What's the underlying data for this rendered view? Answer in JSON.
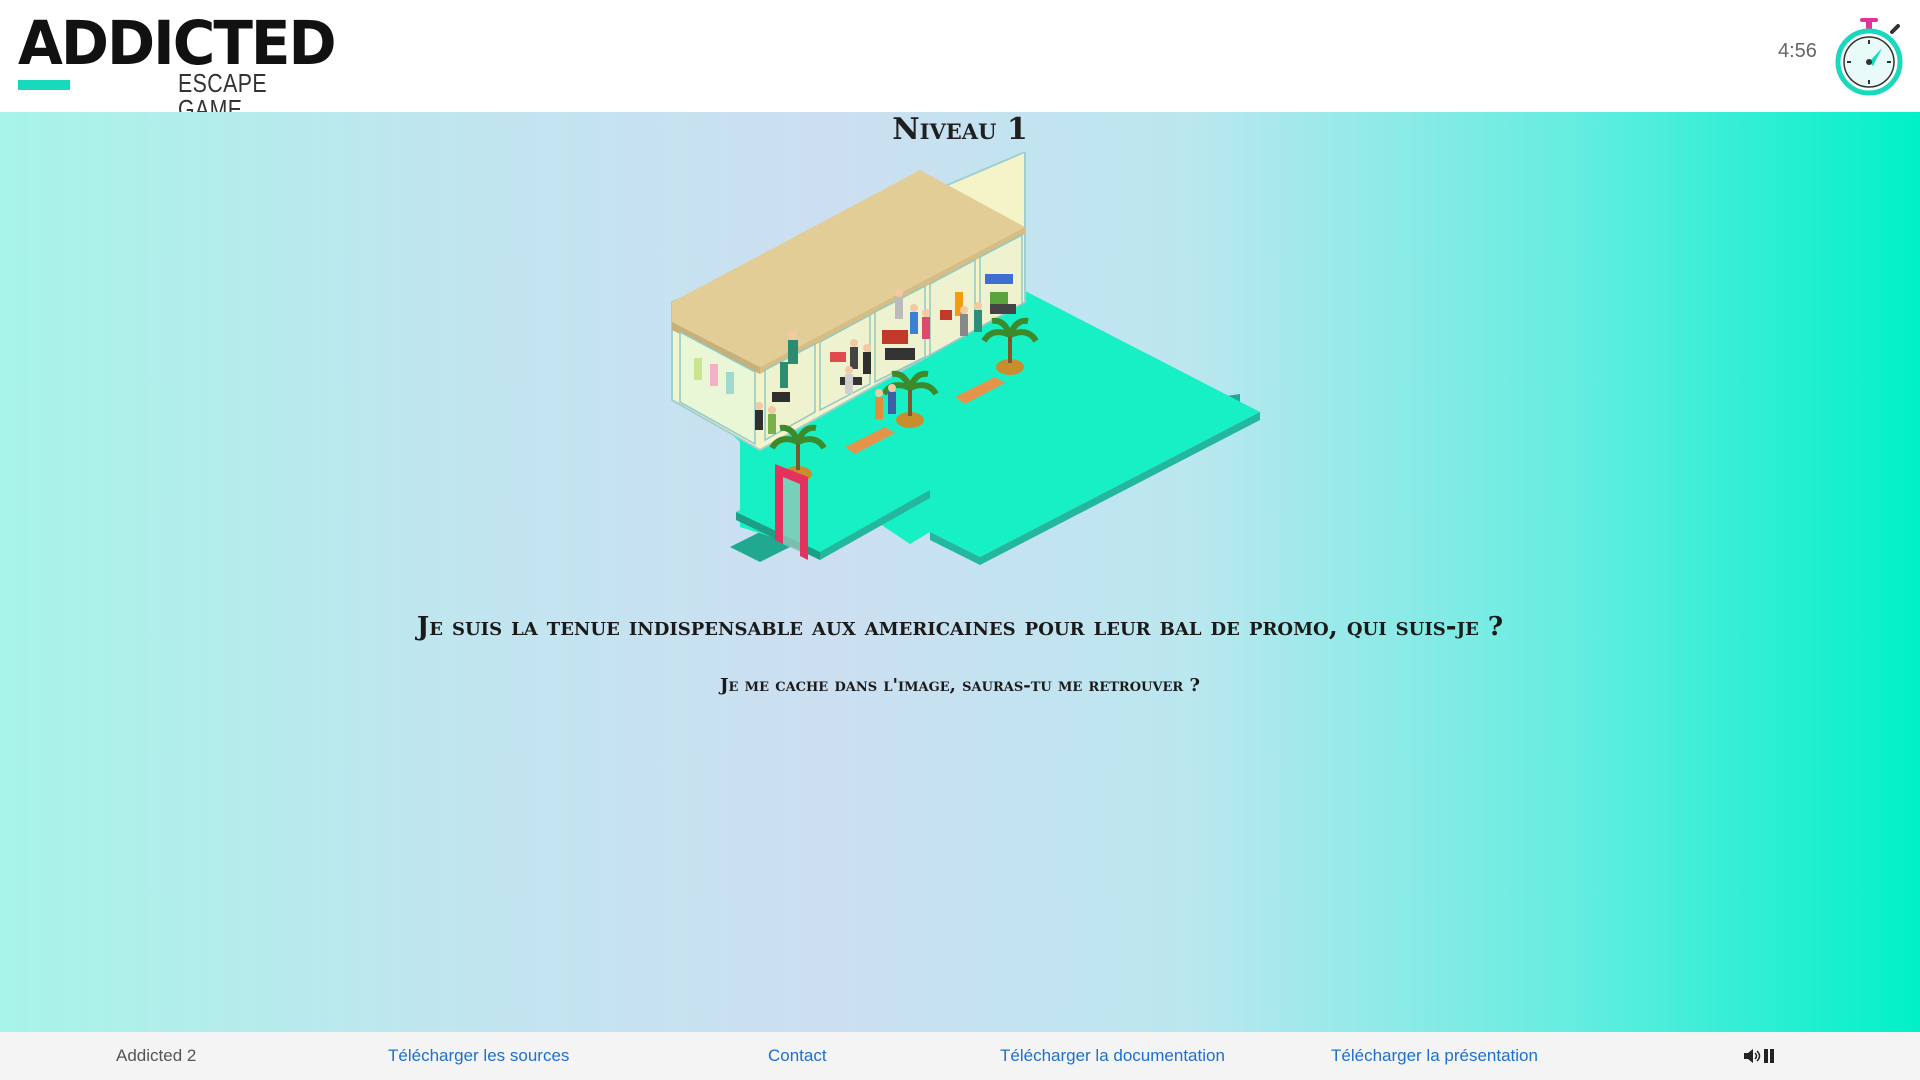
{
  "header": {
    "logo_main": "ADDICTED",
    "logo_sub": "ESCAPE GAME",
    "timer": "4:56",
    "colors": {
      "accent": "#19d9bd",
      "timer_pink": "#e2339a"
    }
  },
  "level": {
    "title": "Niveau 1",
    "question": "Je suis la tenue indispensable aux americaines pour leur bal de promo, qui suis-je ?",
    "hint": "Je me cache dans l'image, sauras-tu me retrouver ?"
  },
  "scene": {
    "description_icon": "isometric-mall-illustration"
  },
  "footer": {
    "brand": "Addicted 2",
    "links": {
      "sources": "Télécharger les sources",
      "contact": "Contact",
      "documentation": "Télécharger la documentation",
      "presentation": "Télécharger la présentation"
    },
    "sound_icon": "speaker-icon",
    "pause_icon": "pause-icon"
  }
}
